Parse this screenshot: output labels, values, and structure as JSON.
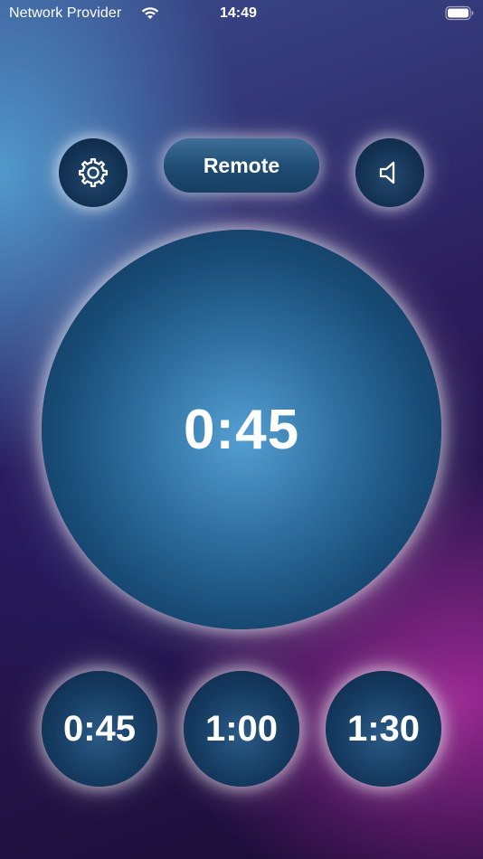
{
  "status_bar": {
    "carrier": "Network Provider",
    "time": "14:49",
    "wifi_icon": "wifi-icon",
    "battery_icon": "battery-icon"
  },
  "toolbar": {
    "settings_icon": "gear-icon",
    "remote_label": "Remote",
    "sound_icon": "speaker-icon"
  },
  "timer": {
    "display": "0:45"
  },
  "presets": [
    {
      "label": "0:45"
    },
    {
      "label": "1:00"
    },
    {
      "label": "1:30"
    }
  ],
  "colors": {
    "button_fill": "#153a60",
    "circle_center": "#549fd3",
    "background_top_left": "#529ed0",
    "background_bottom_right": "#a02a96",
    "text": "#ffffff"
  }
}
